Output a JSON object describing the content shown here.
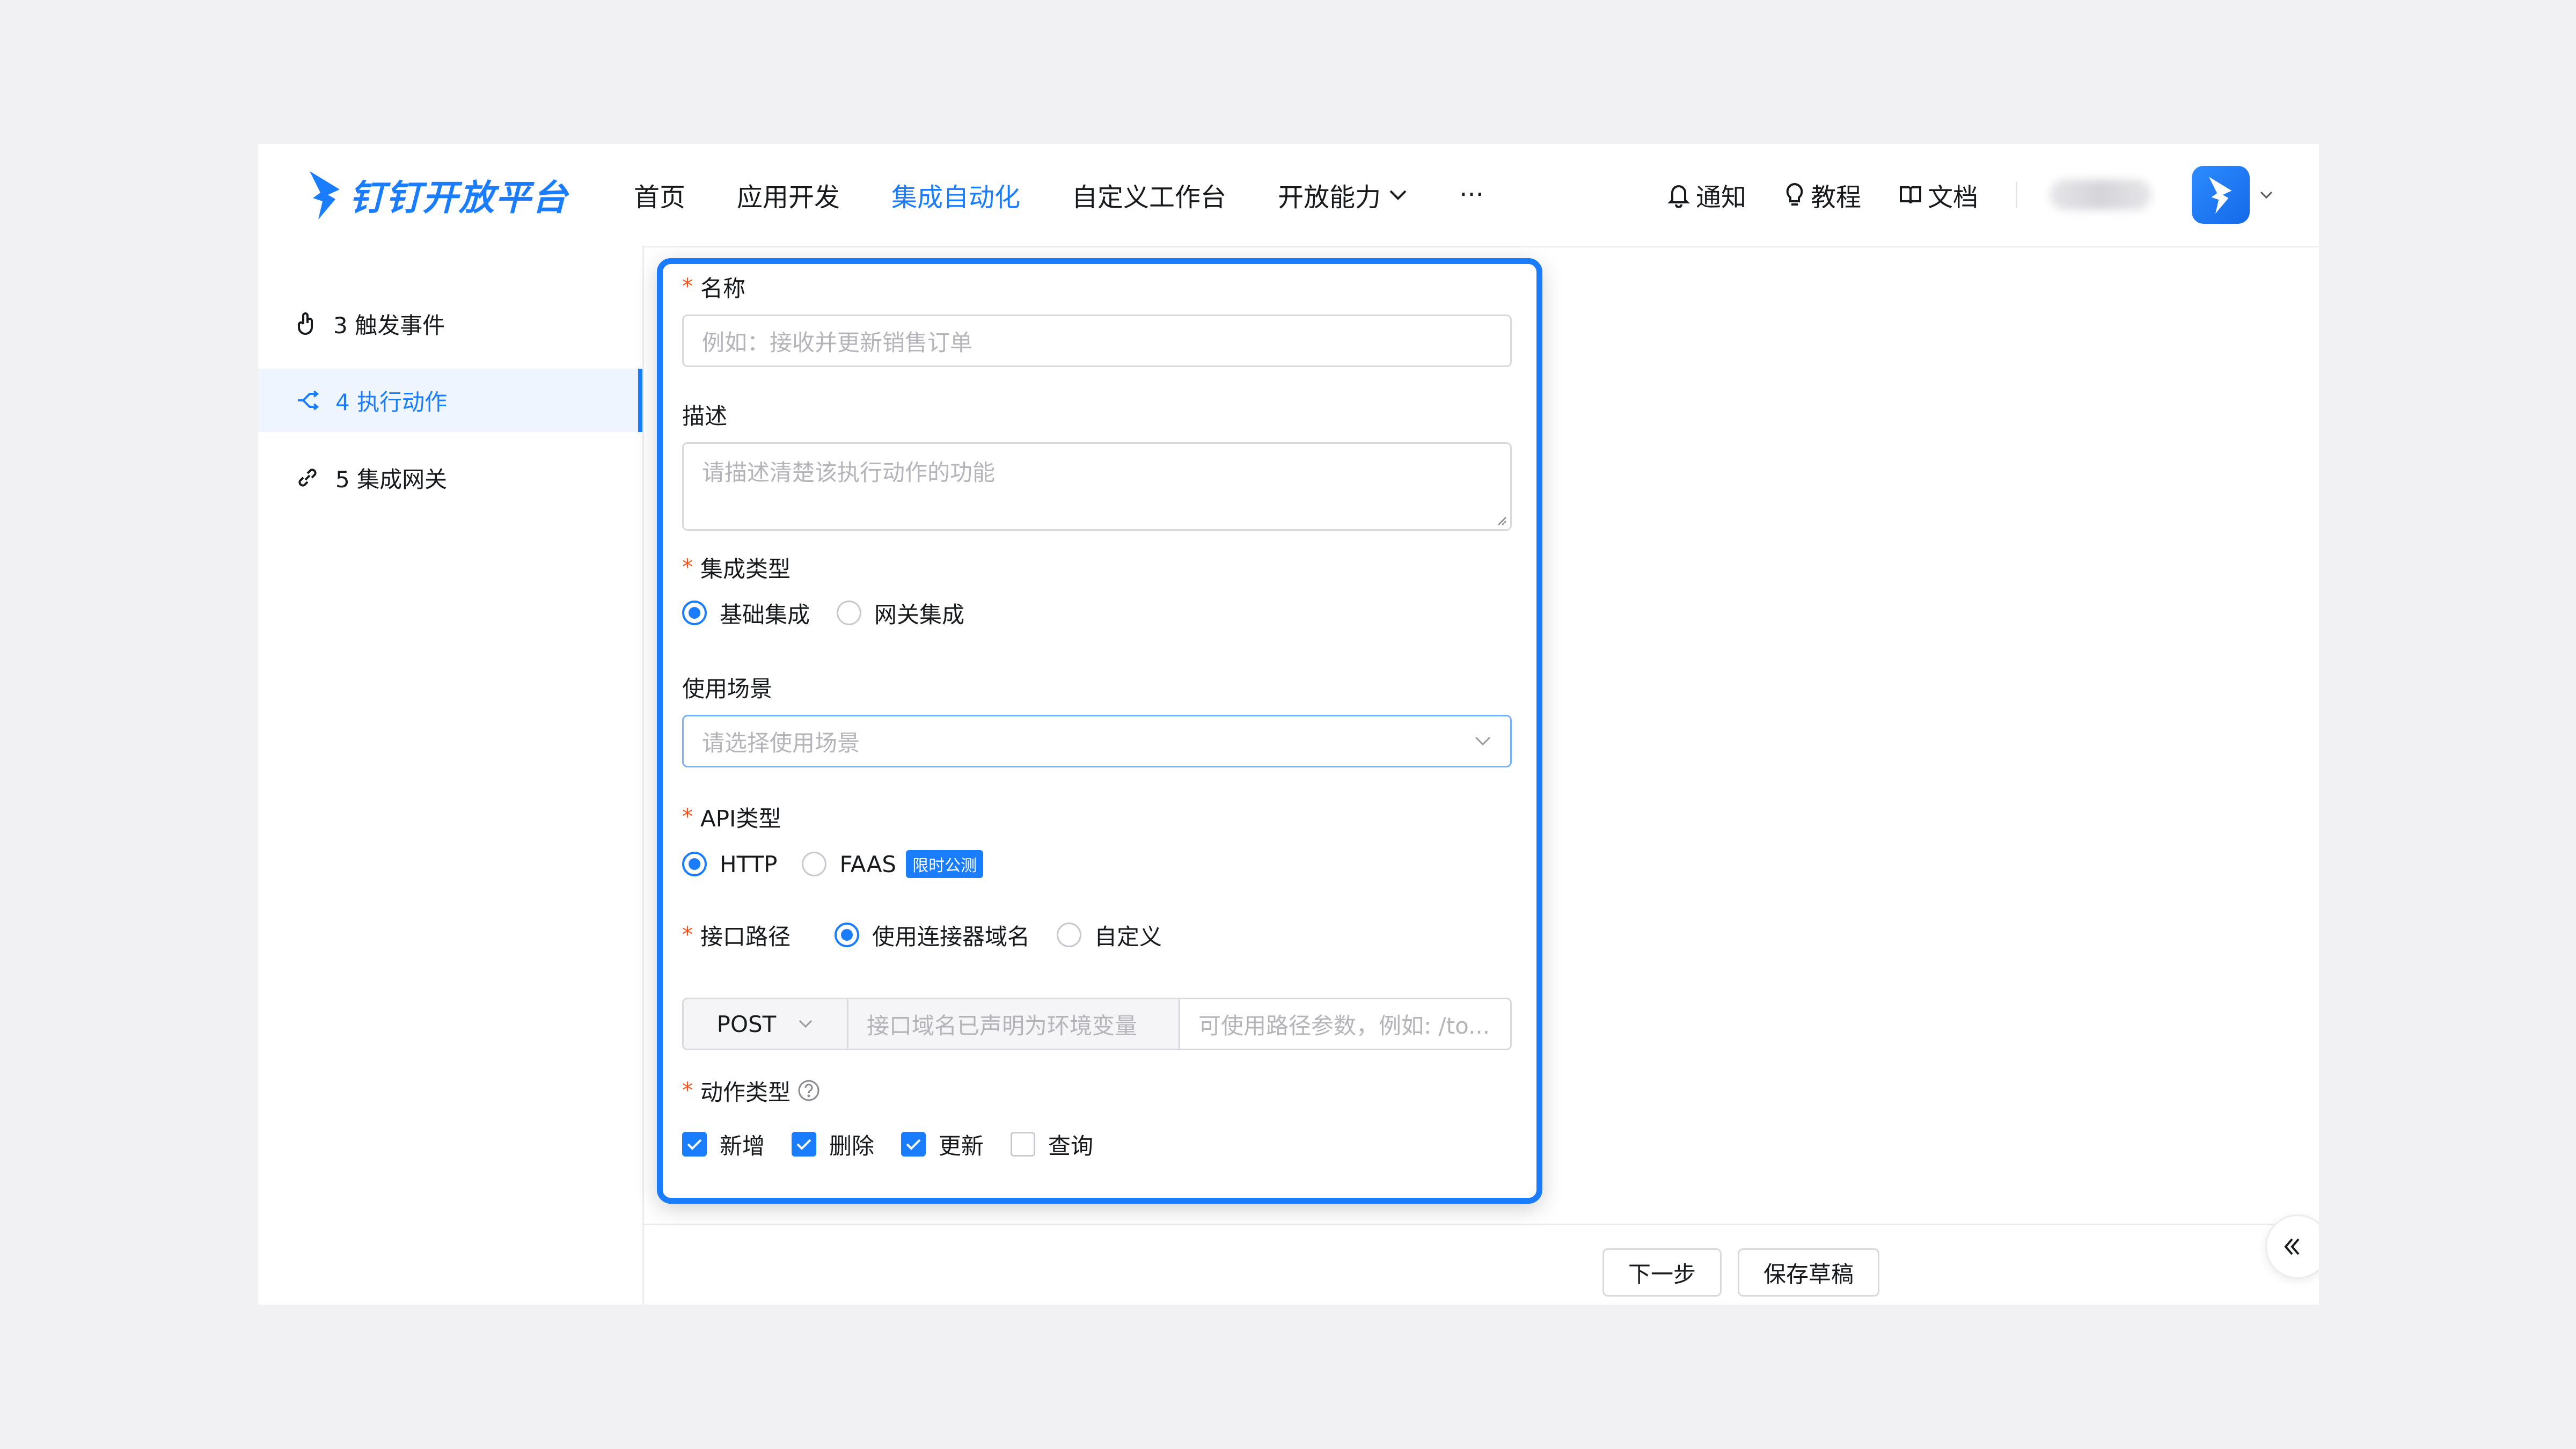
{
  "header": {
    "logo_text": "钉钉开放平台",
    "nav": [
      {
        "label": "首页"
      },
      {
        "label": "应用开发"
      },
      {
        "label": "集成自动化"
      },
      {
        "label": "自定义工作台"
      },
      {
        "label": "开放能力"
      },
      {
        "label": "···"
      }
    ],
    "tools": {
      "notify": "通知",
      "tutorial": "教程",
      "docs": "文档"
    },
    "accent": "#1a7cff"
  },
  "sidebar": {
    "items": [
      {
        "label": "3 触发事件"
      },
      {
        "label": "4 执行动作"
      },
      {
        "label": "5 集成网关"
      }
    ]
  },
  "form": {
    "required_mark": "*",
    "name": {
      "label": "名称",
      "placeholder": "例如：接收并更新销售订单"
    },
    "description": {
      "label": "描述",
      "placeholder": "请描述清楚该执行动作的功能"
    },
    "integration_type": {
      "label": "集成类型",
      "options": [
        "基础集成",
        "网关集成"
      ],
      "selected": "基础集成"
    },
    "scene": {
      "label": "使用场景",
      "placeholder": "请选择使用场景"
    },
    "api_type": {
      "label": "API类型",
      "options": [
        "HTTP",
        "FAAS"
      ],
      "badge": "限时公测",
      "selected": "HTTP"
    },
    "endpoint": {
      "label": "接口路径",
      "options": [
        "使用连接器域名",
        "自定义"
      ],
      "selected": "使用连接器域名",
      "method": "POST",
      "domain_placeholder": "接口域名已声明为环境变量",
      "path_placeholder": "可使用路径参数，例如: /to..."
    },
    "action_type": {
      "label": "动作类型",
      "options": [
        {
          "label": "新增",
          "checked": true
        },
        {
          "label": "删除",
          "checked": true
        },
        {
          "label": "更新",
          "checked": true
        },
        {
          "label": "查询",
          "checked": false
        }
      ]
    }
  },
  "footer": {
    "next": "下一步",
    "save_draft": "保存草稿"
  }
}
